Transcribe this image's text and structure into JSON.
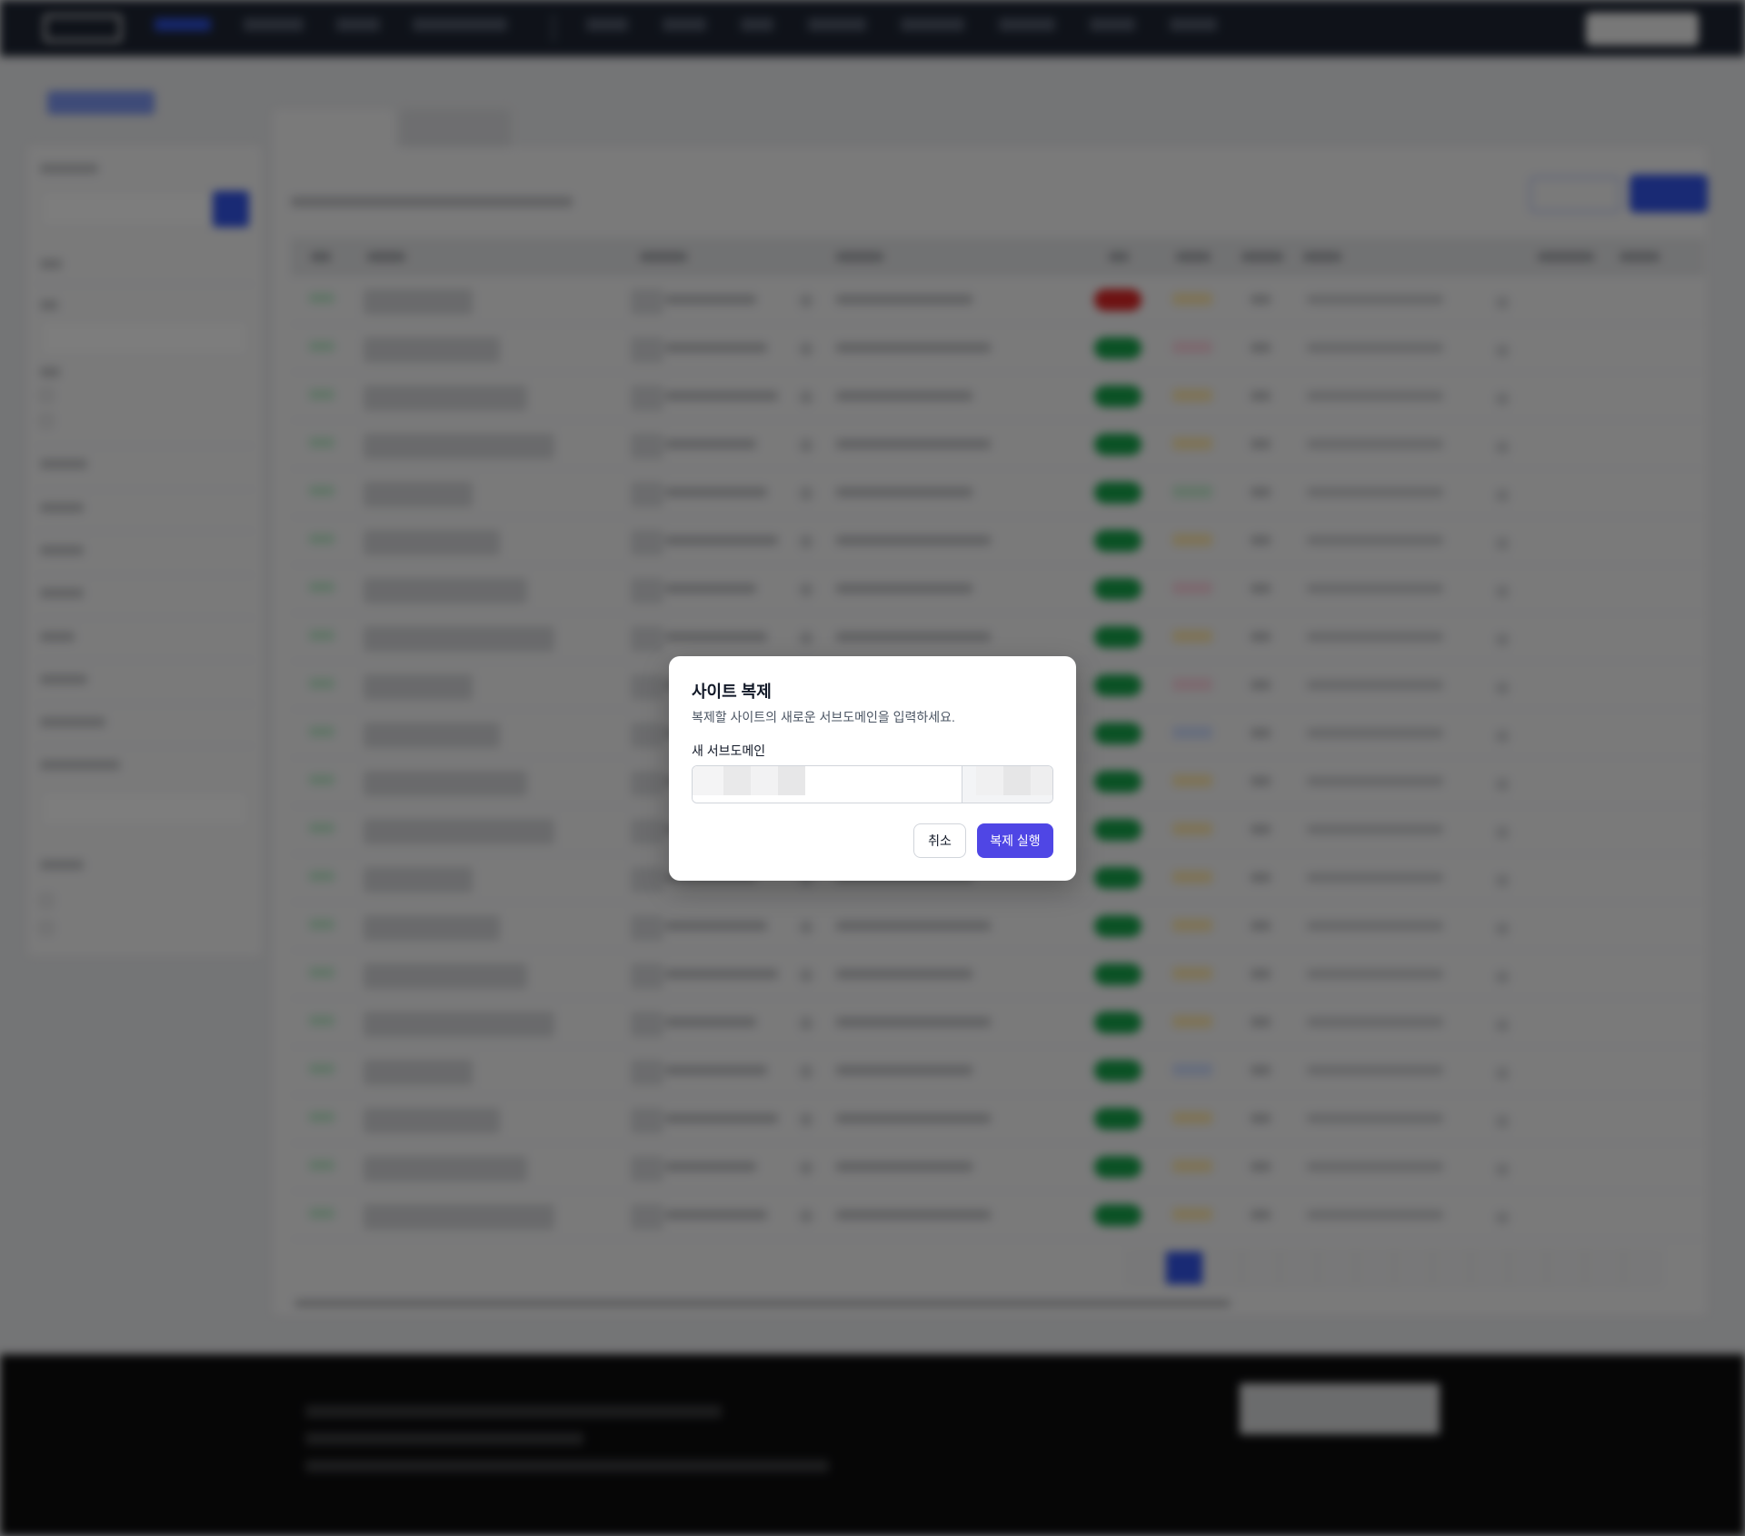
{
  "dialog": {
    "title": "사이트 복제",
    "description": "복제할 사이트의 새로운 서브도메인을 입력하세요.",
    "field_label": "새 서브도메인",
    "subdomain_value": "",
    "domain_suffix": "",
    "cancel_label": "취소",
    "confirm_label": "복제 실행"
  },
  "colors": {
    "confirm_button": "#4f46e5",
    "overlay": "rgba(0,0,0,0.5)",
    "topbar": "#1e2533",
    "accent_blue": "#3254e8",
    "status_green": "#16a34a",
    "status_red": "#dc2626"
  },
  "background": {
    "rows": [
      {
        "status": "red",
        "tag": "amber"
      },
      {
        "status": "green",
        "tag": "pink"
      },
      {
        "status": "green",
        "tag": "amber"
      },
      {
        "status": "green",
        "tag": "amber"
      },
      {
        "status": "green",
        "tag": "green"
      },
      {
        "status": "green",
        "tag": "amber"
      },
      {
        "status": "green",
        "tag": "pink"
      },
      {
        "status": "green",
        "tag": "amber"
      },
      {
        "status": "green",
        "tag": "pink"
      },
      {
        "status": "green",
        "tag": "blue"
      },
      {
        "status": "green",
        "tag": "amber"
      },
      {
        "status": "green",
        "tag": "amber"
      },
      {
        "status": "green",
        "tag": "amber"
      },
      {
        "status": "green",
        "tag": "amber"
      },
      {
        "status": "green",
        "tag": "amber"
      },
      {
        "status": "green",
        "tag": "amber"
      },
      {
        "status": "green",
        "tag": "blue"
      },
      {
        "status": "green",
        "tag": "amber"
      },
      {
        "status": "green",
        "tag": "amber"
      },
      {
        "status": "green",
        "tag": "amber"
      }
    ],
    "pages": 14,
    "active_page": 2
  }
}
